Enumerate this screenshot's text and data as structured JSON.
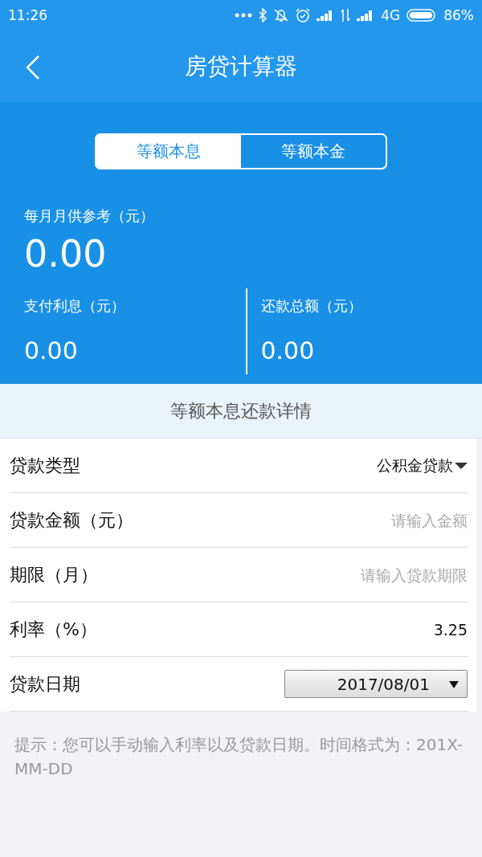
{
  "status_bar": {
    "time": "11:26",
    "network": "4G",
    "battery": "86%"
  },
  "header": {
    "title": "房贷计算器"
  },
  "tabs": [
    {
      "label": "等额本息",
      "selected": true
    },
    {
      "label": "等额本金",
      "selected": false
    }
  ],
  "summary": {
    "monthly_label": "每月月供参考（元）",
    "monthly_value": "0.00",
    "stats": [
      {
        "label": "支付利息（元）",
        "value": "0.00"
      },
      {
        "label": "还款总额（元）",
        "value": "0.00"
      }
    ]
  },
  "section_title": "等额本息还款详情",
  "form": [
    {
      "kind": "dropdown",
      "label": "贷款类型",
      "value": "公积金贷款"
    },
    {
      "kind": "input",
      "label": "贷款金额（元）",
      "placeholder": "请输入金额"
    },
    {
      "kind": "input",
      "label": "期限（月）",
      "placeholder": "请输入贷款期限"
    },
    {
      "kind": "input",
      "label": "利率（%）",
      "value": "3.25"
    },
    {
      "kind": "date",
      "label": "贷款日期",
      "value": "2017/08/01"
    }
  ],
  "hint": "提示：您可以手动输入利率以及贷款日期。时间格式为：201X-MM-DD"
}
